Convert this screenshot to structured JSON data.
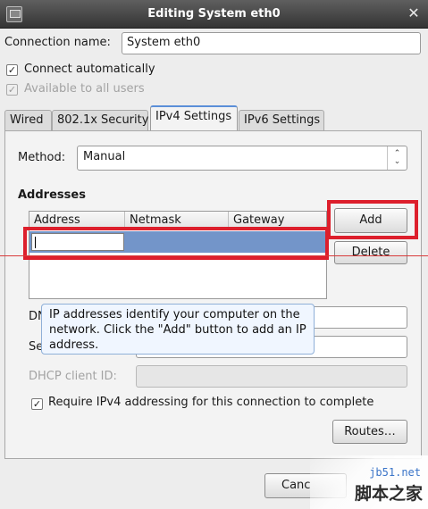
{
  "window": {
    "title": "Editing System eth0"
  },
  "connection": {
    "name_label": "Connection name:",
    "name_value": "System eth0",
    "connect_auto_label": "Connect automatically",
    "connect_auto_checked": true,
    "available_all_label": "Available to all users",
    "available_all_checked": true
  },
  "tabs": [
    {
      "label": "Wired",
      "active": false
    },
    {
      "label": "802.1x Security",
      "active": false
    },
    {
      "label": "IPv4 Settings",
      "active": true
    },
    {
      "label": "IPv6 Settings",
      "active": false
    }
  ],
  "ipv4": {
    "method_label": "Method:",
    "method_value": "Manual",
    "addresses_label": "Addresses",
    "columns": [
      "Address",
      "Netmask",
      "Gateway"
    ],
    "rows": [
      {
        "address": "",
        "netmask": "",
        "gateway": ""
      }
    ],
    "add_label": "Add",
    "delete_label": "Delete",
    "dns_label_visible": "DN",
    "search_label_visible": "Se",
    "dhcp_client_label": "DHCP client ID:",
    "require_ipv4_label": "Require IPv4 addressing for this connection to complete",
    "require_ipv4_checked": true,
    "routes_label": "Routes…",
    "tooltip": "IP addresses identify your computer on the network.  Click the \"Add\" button to add an IP address."
  },
  "footer": {
    "cancel_label_visible": "Canc"
  },
  "watermark": {
    "site": "jb51.net",
    "text": "脚本之家"
  },
  "colors": {
    "highlight_box": "#dd1f2c",
    "selection": "#7395c9",
    "tooltip_bg": "#f0f6ff"
  }
}
